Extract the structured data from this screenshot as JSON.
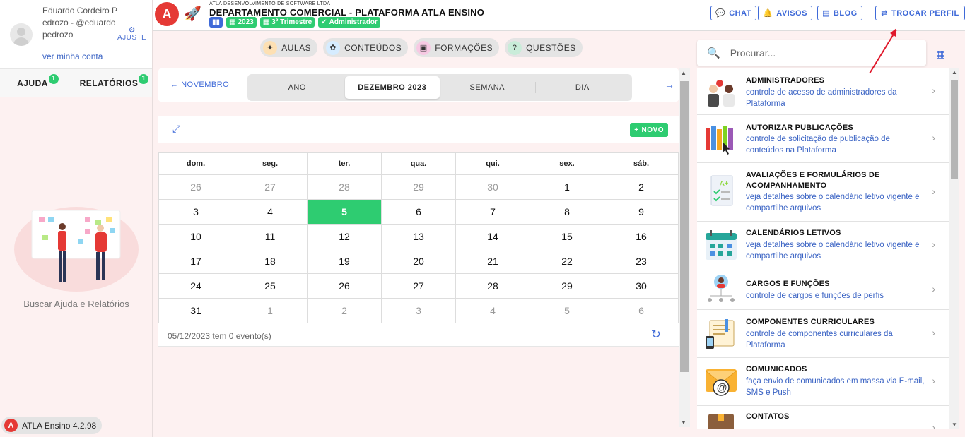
{
  "user": {
    "name": "Eduardo Cordeiro Pedrozo - @eduardopedrozo",
    "my_account": "ver minha conta",
    "settings_label": "AJUSTE"
  },
  "left_tabs": [
    {
      "label": "AJUDA",
      "badge": "1"
    },
    {
      "label": "RELATÓRIOS",
      "badge": "1"
    }
  ],
  "help_text": "Buscar Ajuda e Relatórios",
  "version": {
    "logo": "A",
    "label": "ATLA Ensino 4.2.98"
  },
  "header": {
    "logo": "A",
    "company": "ATLA DESENVOLVIMENTO DE SOFTWARE LTDA",
    "department": "DEPARTAMENTO COMERCIAL - PLATAFORMA ATLA ENSINO",
    "chips": [
      {
        "icon": "bar-chart-icon",
        "label": ""
      },
      {
        "icon": "calendar-icon",
        "label": "2023"
      },
      {
        "icon": "calendar-icon",
        "label": "3º Trimestre"
      },
      {
        "icon": "check-circle-icon",
        "label": "Administrador"
      }
    ],
    "buttons": {
      "chat": "CHAT",
      "avisos": "AVISOS",
      "blog": "BLOG",
      "trocar_perfil": "TROCAR PERFIL"
    }
  },
  "nav_pills": [
    {
      "label": "AULAS",
      "icon": "classes-icon"
    },
    {
      "label": "CONTEÚDOS",
      "icon": "contents-icon"
    },
    {
      "label": "FORMAÇÕES",
      "icon": "trainings-icon"
    },
    {
      "label": "QUESTÕES",
      "icon": "questions-icon"
    }
  ],
  "calendar": {
    "prev_label": "NOVEMBRO",
    "views": [
      "ANO",
      "DEZEMBRO 2023",
      "SEMANA",
      "DIA"
    ],
    "active_view": 1,
    "new_button": "NOVO",
    "weekdays": [
      "dom.",
      "seg.",
      "ter.",
      "qua.",
      "qui.",
      "sex.",
      "sáb."
    ],
    "weeks": [
      [
        "26",
        "27",
        "28",
        "29",
        "30",
        "1",
        "2"
      ],
      [
        "3",
        "4",
        "5",
        "6",
        "7",
        "8",
        "9"
      ],
      [
        "10",
        "11",
        "12",
        "13",
        "14",
        "15",
        "16"
      ],
      [
        "17",
        "18",
        "19",
        "20",
        "21",
        "22",
        "23"
      ],
      [
        "24",
        "25",
        "26",
        "27",
        "28",
        "29",
        "30"
      ],
      [
        "31",
        "1",
        "2",
        "3",
        "4",
        "5",
        "6"
      ]
    ],
    "today": "5",
    "events_text": "05/12/2023 tem 0 evento(s)"
  },
  "search": {
    "placeholder": "Procurar..."
  },
  "modules": [
    {
      "title": "ADMINISTRADORES",
      "desc": "controle de acesso de administradores da Plataforma",
      "icon": "administrators-icon"
    },
    {
      "title": "AUTORIZAR PUBLICAÇÕES",
      "desc": "controle de solicitação de publicação de conteúdos na Plataforma",
      "icon": "books-icon"
    },
    {
      "title": "AVALIAÇÕES E FORMULÁRIOS DE ACOMPANHAMENTO",
      "desc": "veja detalhes sobre o calendário letivo vigente e compartilhe arquivos",
      "icon": "grades-form-icon"
    },
    {
      "title": "CALENDÁRIOS LETIVOS",
      "desc": "veja detalhes sobre o calendário letivo vigente e compartilhe arquivos",
      "icon": "school-calendar-icon"
    },
    {
      "title": "CARGOS E FUNÇÕES",
      "desc": "controle de cargos e funções de perfis",
      "icon": "org-chart-icon"
    },
    {
      "title": "COMPONENTES CURRICULARES",
      "desc": "controle de componentes curriculares da Plataforma",
      "icon": "notebook-icon"
    },
    {
      "title": "COMUNICADOS",
      "desc": "faça envio de comunicados em massa via E-mail, SMS e Push",
      "icon": "email-icon"
    },
    {
      "title": "CONTATOS",
      "desc": "",
      "icon": "contacts-icon"
    }
  ],
  "colors": {
    "accent": "#3f6ad8",
    "success": "#2ecc71",
    "brand": "#e53935",
    "annotation": "#e0182b"
  }
}
